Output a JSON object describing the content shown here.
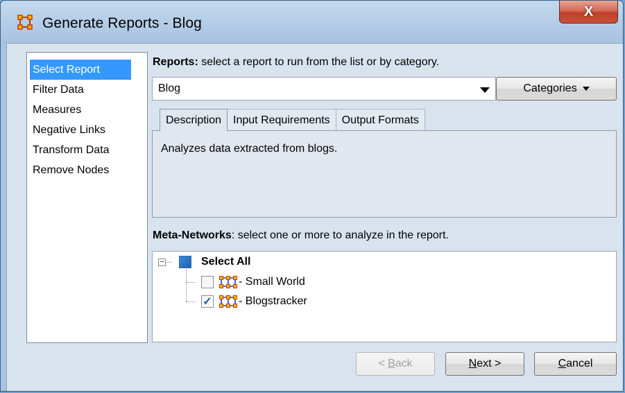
{
  "window": {
    "title": "Generate Reports - Blog",
    "close_label": "X"
  },
  "sidebar": {
    "items": [
      {
        "label": "Select Report",
        "selected": true
      },
      {
        "label": "Filter Data",
        "selected": false
      },
      {
        "label": "Measures",
        "selected": false
      },
      {
        "label": "Negative Links",
        "selected": false
      },
      {
        "label": "Transform Data",
        "selected": false
      },
      {
        "label": "Remove Nodes",
        "selected": false
      }
    ]
  },
  "reports": {
    "label_bold": "Reports:",
    "label_rest": " select a report to run from the list or by category.",
    "selected_report": "Blog",
    "categories_label": "Categories"
  },
  "tabs": [
    {
      "label": "Description",
      "active": true
    },
    {
      "label": "Input Requirements",
      "active": false
    },
    {
      "label": "Output Formats",
      "active": false
    }
  ],
  "description_text": "Analyzes data extracted from blogs.",
  "meta_networks": {
    "label_bold": "Meta-Networks",
    "label_rest": ": select one or more to analyze in the report.",
    "select_all_label": "Select All",
    "items": [
      {
        "label": "- Small World",
        "checked": false
      },
      {
        "label": "- Blogstracker",
        "checked": true
      }
    ]
  },
  "buttons": {
    "back": {
      "accel": "B",
      "prefix": "< ",
      "rest": "ack"
    },
    "next": {
      "accel": "N",
      "rest": "ext >"
    },
    "cancel": {
      "accel": "C",
      "rest": "ancel"
    }
  }
}
